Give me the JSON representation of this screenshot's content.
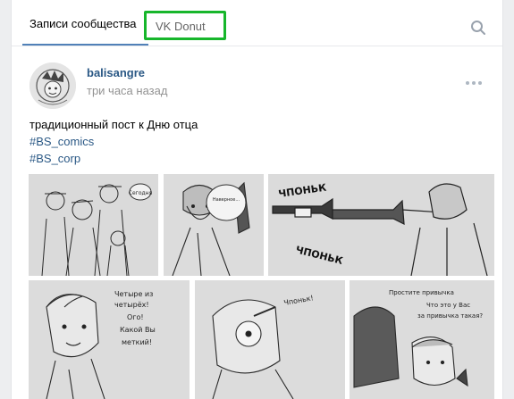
{
  "tabs": {
    "community_posts": "Записи сообщества",
    "vk_donut": "VK Donut"
  },
  "post": {
    "author": "balisangre",
    "time": "три часа назад",
    "text": "традиционный пост к Дню отца",
    "hashtags": [
      "#BS_comics",
      "#BS_corp"
    ]
  },
  "comic": {
    "panel1_bubble": "Сегодня",
    "panel2_bubble": "Наверное... Не твоего мне дела спрашивать, но довольна?",
    "panel3_sfx1": "ЧПОНЬК",
    "panel3_sfx2": "ЧПОНЬК",
    "panel4_bubble": "Четыре из четырёх! Ого! Какой Вы меткий!",
    "panel5_bubble": "Чпоньк!",
    "panel6_bubble": "Простите привычка Что это у Вас за привычка такая?"
  },
  "colors": {
    "accent": "#5181b8",
    "link": "#2a5885",
    "highlight": "#17b62b"
  }
}
